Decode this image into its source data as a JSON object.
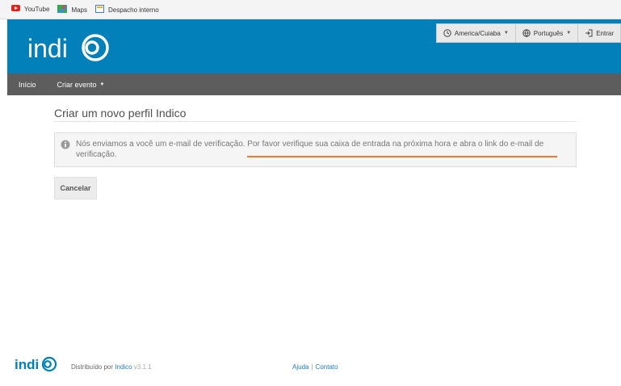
{
  "bookmarks": [
    {
      "label": "YouTube",
      "icon": "youtube-icon"
    },
    {
      "label": "Maps",
      "icon": "maps-icon"
    },
    {
      "label": "Despacho interno",
      "icon": "document-icon"
    }
  ],
  "header": {
    "logo_text": "indico",
    "timezone": "America/Cuiaba",
    "language": "Português",
    "login": "Entrar"
  },
  "nav": {
    "home": "Início",
    "create_event": "Criar evento"
  },
  "main": {
    "title": "Criar um novo perfil Indico",
    "message": "Nós enviamos a você um e-mail de verificação. Por favor verifique sua caixa de entrada na próxima hora e abra o link do e-mail de verificação.",
    "cancel": "Cancelar"
  },
  "footer": {
    "distributed_by": "Distribuído por",
    "brand_link": "Indico",
    "version": "v3.1.1",
    "help": "Ajuda",
    "separator": "|",
    "contact": "Contato"
  },
  "colors": {
    "header_bg": "#0180ba",
    "navbar_bg": "#5d5d5d",
    "annotation_underline": "#e97d2a",
    "link": "#1a7ec1"
  }
}
